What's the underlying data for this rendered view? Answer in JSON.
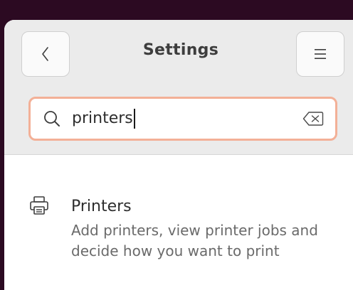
{
  "header": {
    "title": "Settings",
    "back_icon": "chevron-left-icon",
    "menu_icon": "hamburger-menu-icon"
  },
  "search": {
    "value": "printers",
    "search_icon": "search-icon",
    "clear_icon": "clear-text-icon",
    "focus_color": "#f3b097"
  },
  "results": [
    {
      "icon": "printer-icon",
      "title": "Printers",
      "description": "Add printers, view printer jobs and decide how you want to print"
    }
  ]
}
